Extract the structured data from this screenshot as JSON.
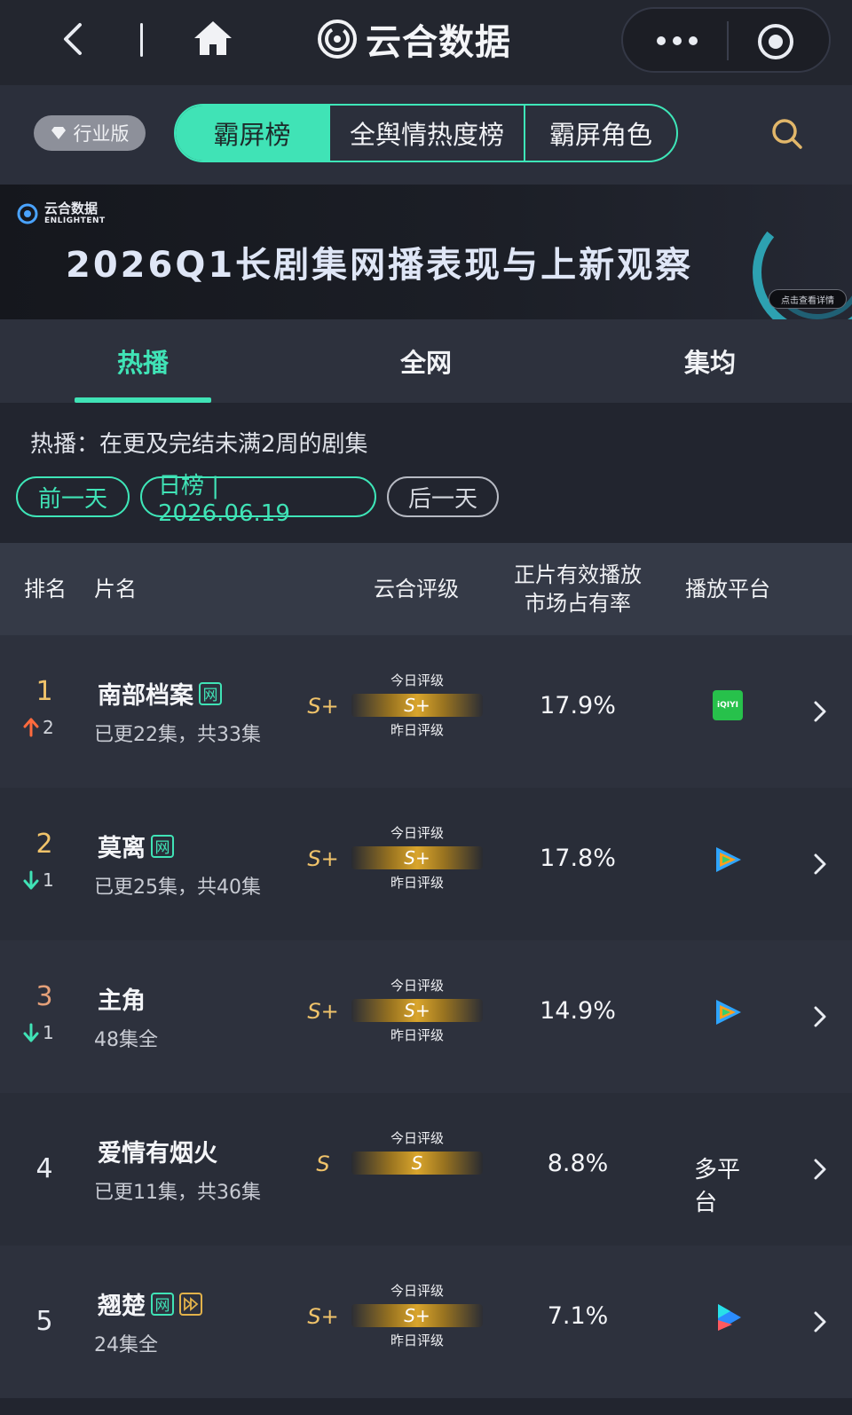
{
  "nav": {
    "app_title": "云合数据"
  },
  "rank_nav": {
    "industry_badge": "行业版",
    "tabs": [
      {
        "label": "霸屏榜",
        "active": true
      },
      {
        "label": "全舆情热度榜",
        "active": false
      },
      {
        "label": "霸屏角色",
        "active": false
      }
    ]
  },
  "banner": {
    "logo_cn": "云合数据",
    "logo_en": "ENLIGHTENT",
    "title": "2026Q1长剧集网播表现与上新观察",
    "cta": "点击查看详情"
  },
  "sub_tabs": [
    {
      "label": "热播",
      "active": true
    },
    {
      "label": "全网",
      "active": false
    },
    {
      "label": "集均",
      "active": false
    }
  ],
  "description": "热播：在更及完结未满2周的剧集",
  "date_nav": {
    "prev": "前一天",
    "current": "日榜 | 2026.06.19",
    "next": "后一天"
  },
  "table": {
    "headers": {
      "rank": "排名",
      "name": "片名",
      "rating": "云合评级",
      "share_line1": "正片有效播放",
      "share_line2": "市场占有率",
      "platform": "播放平台"
    },
    "gauge_today_label": "今日评级",
    "gauge_yesterday_label": "昨日评级",
    "rows": [
      {
        "rank": "1",
        "change": "2",
        "direction": "up",
        "title": "南部档案",
        "net_tag": "网",
        "play_tag": false,
        "episodes": "已更22集，共33集",
        "grade": "S+",
        "gauge": "S+",
        "show_yesterday": true,
        "share": "17.9%",
        "platform": "iqiyi",
        "platform_label": "iQIYI",
        "rank_color": "#f0c36a"
      },
      {
        "rank": "2",
        "change": "1",
        "direction": "down",
        "title": "莫离",
        "net_tag": "网",
        "play_tag": false,
        "episodes": "已更25集，共40集",
        "grade": "S+",
        "gauge": "S+",
        "show_yesterday": true,
        "share": "17.8%",
        "platform": "tencent",
        "platform_label": "",
        "rank_color": "#f0c36a"
      },
      {
        "rank": "3",
        "change": "1",
        "direction": "down",
        "title": "主角",
        "net_tag": "",
        "play_tag": false,
        "episodes": "48集全",
        "grade": "S+",
        "gauge": "S+",
        "show_yesterday": true,
        "share": "14.9%",
        "platform": "tencent",
        "platform_label": "",
        "rank_color": "#e4a079"
      },
      {
        "rank": "4",
        "change": "",
        "direction": "none",
        "title": "爱情有烟火",
        "net_tag": "",
        "play_tag": false,
        "episodes": "已更11集，共36集",
        "grade": "S",
        "gauge": "S",
        "show_yesterday": false,
        "share": "8.8%",
        "platform": "multi",
        "platform_label": "多平台",
        "rank_color": "#e9ecf2"
      },
      {
        "rank": "5",
        "change": "",
        "direction": "none",
        "title": "翘楚",
        "net_tag": "网",
        "play_tag": true,
        "episodes": "24集全",
        "grade": "S+",
        "gauge": "S+",
        "show_yesterday": true,
        "share": "7.1%",
        "platform": "youku",
        "platform_label": "",
        "rank_color": "#e9ecf2"
      }
    ]
  },
  "colors": {
    "accent": "#40e3b6",
    "gold": "#f0c36a",
    "background": "#22252f"
  }
}
